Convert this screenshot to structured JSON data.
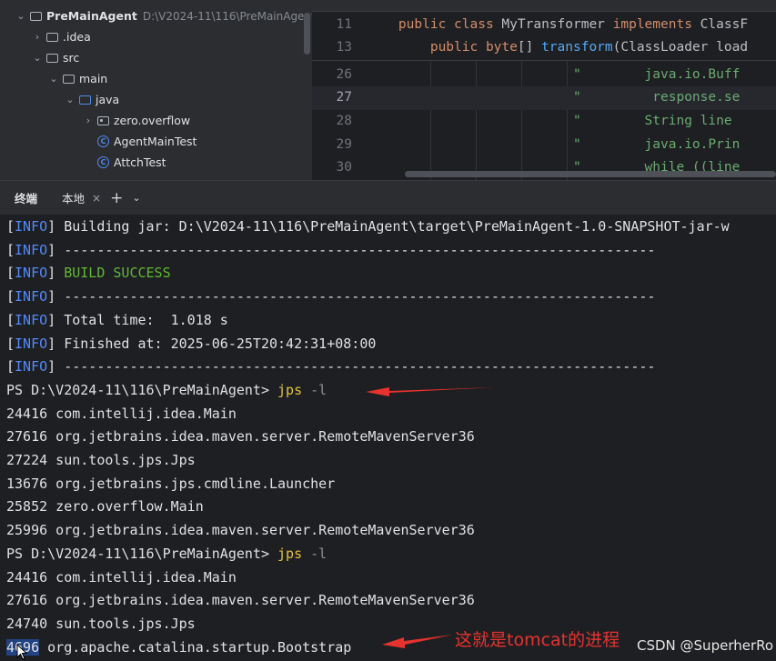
{
  "project_tree": {
    "items": [
      {
        "chevron": "⌄",
        "icon": "module",
        "label": "PreMainAgent",
        "path": "D:\\V2024-11\\116\\PreMainAgent",
        "bold": true
      },
      {
        "chevron": "›",
        "icon": "folder",
        "label": ".idea"
      },
      {
        "chevron": "⌄",
        "icon": "folder",
        "label": "src"
      },
      {
        "chevron": "⌄",
        "icon": "folder",
        "label": "main"
      },
      {
        "chevron": "⌄",
        "icon": "folder-blue",
        "label": "java"
      },
      {
        "chevron": "›",
        "icon": "package",
        "label": "zero.overflow"
      },
      {
        "chevron": "",
        "icon": "class",
        "label": "AgentMainTest"
      },
      {
        "chevron": "",
        "icon": "class",
        "label": "AttchTest"
      }
    ]
  },
  "editor": {
    "lines": [
      {
        "num": "11",
        "code": [
          [
            "    ",
            ""
          ],
          [
            "public class ",
            "kw"
          ],
          [
            "MyTransformer ",
            ""
          ],
          [
            "implements ",
            "kw"
          ],
          [
            "ClassF",
            ""
          ]
        ]
      },
      {
        "num": "13",
        "code": [
          [
            "        ",
            ""
          ],
          [
            "public byte",
            "kw"
          ],
          [
            "[] ",
            ""
          ],
          [
            "transform",
            "fn"
          ],
          [
            "(ClassLoader load",
            ""
          ]
        ]
      },
      {
        "num": "26",
        "code": [
          [
            "                          ",
            ""
          ],
          [
            "\"        java.io.Buff",
            "str"
          ]
        ]
      },
      {
        "num": "27",
        "code": [
          [
            "                          ",
            ""
          ],
          [
            "\"         response.se",
            "str"
          ]
        ]
      },
      {
        "num": "28",
        "code": [
          [
            "                          ",
            ""
          ],
          [
            "\"        String line",
            "str"
          ]
        ]
      },
      {
        "num": "29",
        "code": [
          [
            "                          ",
            ""
          ],
          [
            "\"        java.io.Prin",
            "str"
          ]
        ]
      },
      {
        "num": "30",
        "code": [
          [
            "                          ",
            ""
          ],
          [
            "\"        while ((line",
            "str"
          ]
        ]
      }
    ],
    "current_line": "27"
  },
  "terminal_header": {
    "title": "终端",
    "tab_local": "本地",
    "close_glyph": "×",
    "add_glyph": "+",
    "more_glyph": "⌄"
  },
  "terminal": {
    "lines": [
      [
        [
          "[",
          ""
        ],
        [
          "INFO",
          "info"
        ],
        [
          "] Building jar: D:\\V2024-11\\116\\PreMainAgent\\target\\PreMainAgent-1.0-SNAPSHOT-jar-w",
          ""
        ]
      ],
      [
        [
          "[",
          ""
        ],
        [
          "INFO",
          "info"
        ],
        [
          "] ------------------------------------------------------------------------",
          ""
        ]
      ],
      [
        [
          "[",
          ""
        ],
        [
          "INFO",
          "info"
        ],
        [
          "] ",
          ""
        ],
        [
          "BUILD SUCCESS",
          "success"
        ]
      ],
      [
        [
          "[",
          ""
        ],
        [
          "INFO",
          "info"
        ],
        [
          "] ------------------------------------------------------------------------",
          ""
        ]
      ],
      [
        [
          "[",
          ""
        ],
        [
          "INFO",
          "info"
        ],
        [
          "] Total time:  1.018 s",
          ""
        ]
      ],
      [
        [
          "[",
          ""
        ],
        [
          "INFO",
          "info"
        ],
        [
          "] Finished at: 2025-06-25T20:42:31+08:00",
          ""
        ]
      ],
      [
        [
          "[",
          ""
        ],
        [
          "INFO",
          "info"
        ],
        [
          "] ------------------------------------------------------------------------",
          ""
        ]
      ],
      [
        [
          "PS D:\\V2024-11\\116\\PreMainAgent> ",
          ""
        ],
        [
          "jps",
          "cmd"
        ],
        [
          " -l",
          "arg"
        ]
      ],
      [
        [
          "24416 com.intellij.idea.Main",
          ""
        ]
      ],
      [
        [
          "27616 org.jetbrains.idea.maven.server.RemoteMavenServer36",
          ""
        ]
      ],
      [
        [
          "27224 sun.tools.jps.Jps",
          ""
        ]
      ],
      [
        [
          "13676 org.jetbrains.jps.cmdline.Launcher",
          ""
        ]
      ],
      [
        [
          "25852 zero.overflow.Main",
          ""
        ]
      ],
      [
        [
          "25996 org.jetbrains.idea.maven.server.RemoteMavenServer36",
          ""
        ]
      ],
      [
        [
          "PS D:\\V2024-11\\116\\PreMainAgent> ",
          ""
        ],
        [
          "jps",
          "cmd"
        ],
        [
          " -l",
          "arg"
        ]
      ],
      [
        [
          "24416 com.intellij.idea.Main",
          ""
        ]
      ],
      [
        [
          "27616 org.jetbrains.idea.maven.server.RemoteMavenServer36",
          ""
        ]
      ],
      [
        [
          "24740 sun.tools.jps.Jps",
          ""
        ]
      ],
      [
        [
          "4696",
          "pid-hl"
        ],
        [
          " org.apache.catalina.startup.Bootstrap",
          ""
        ]
      ]
    ]
  },
  "annotation": {
    "note": "这就是tomcat的进程",
    "color": "#e8322f"
  },
  "watermark": "CSDN @SuperherRo"
}
